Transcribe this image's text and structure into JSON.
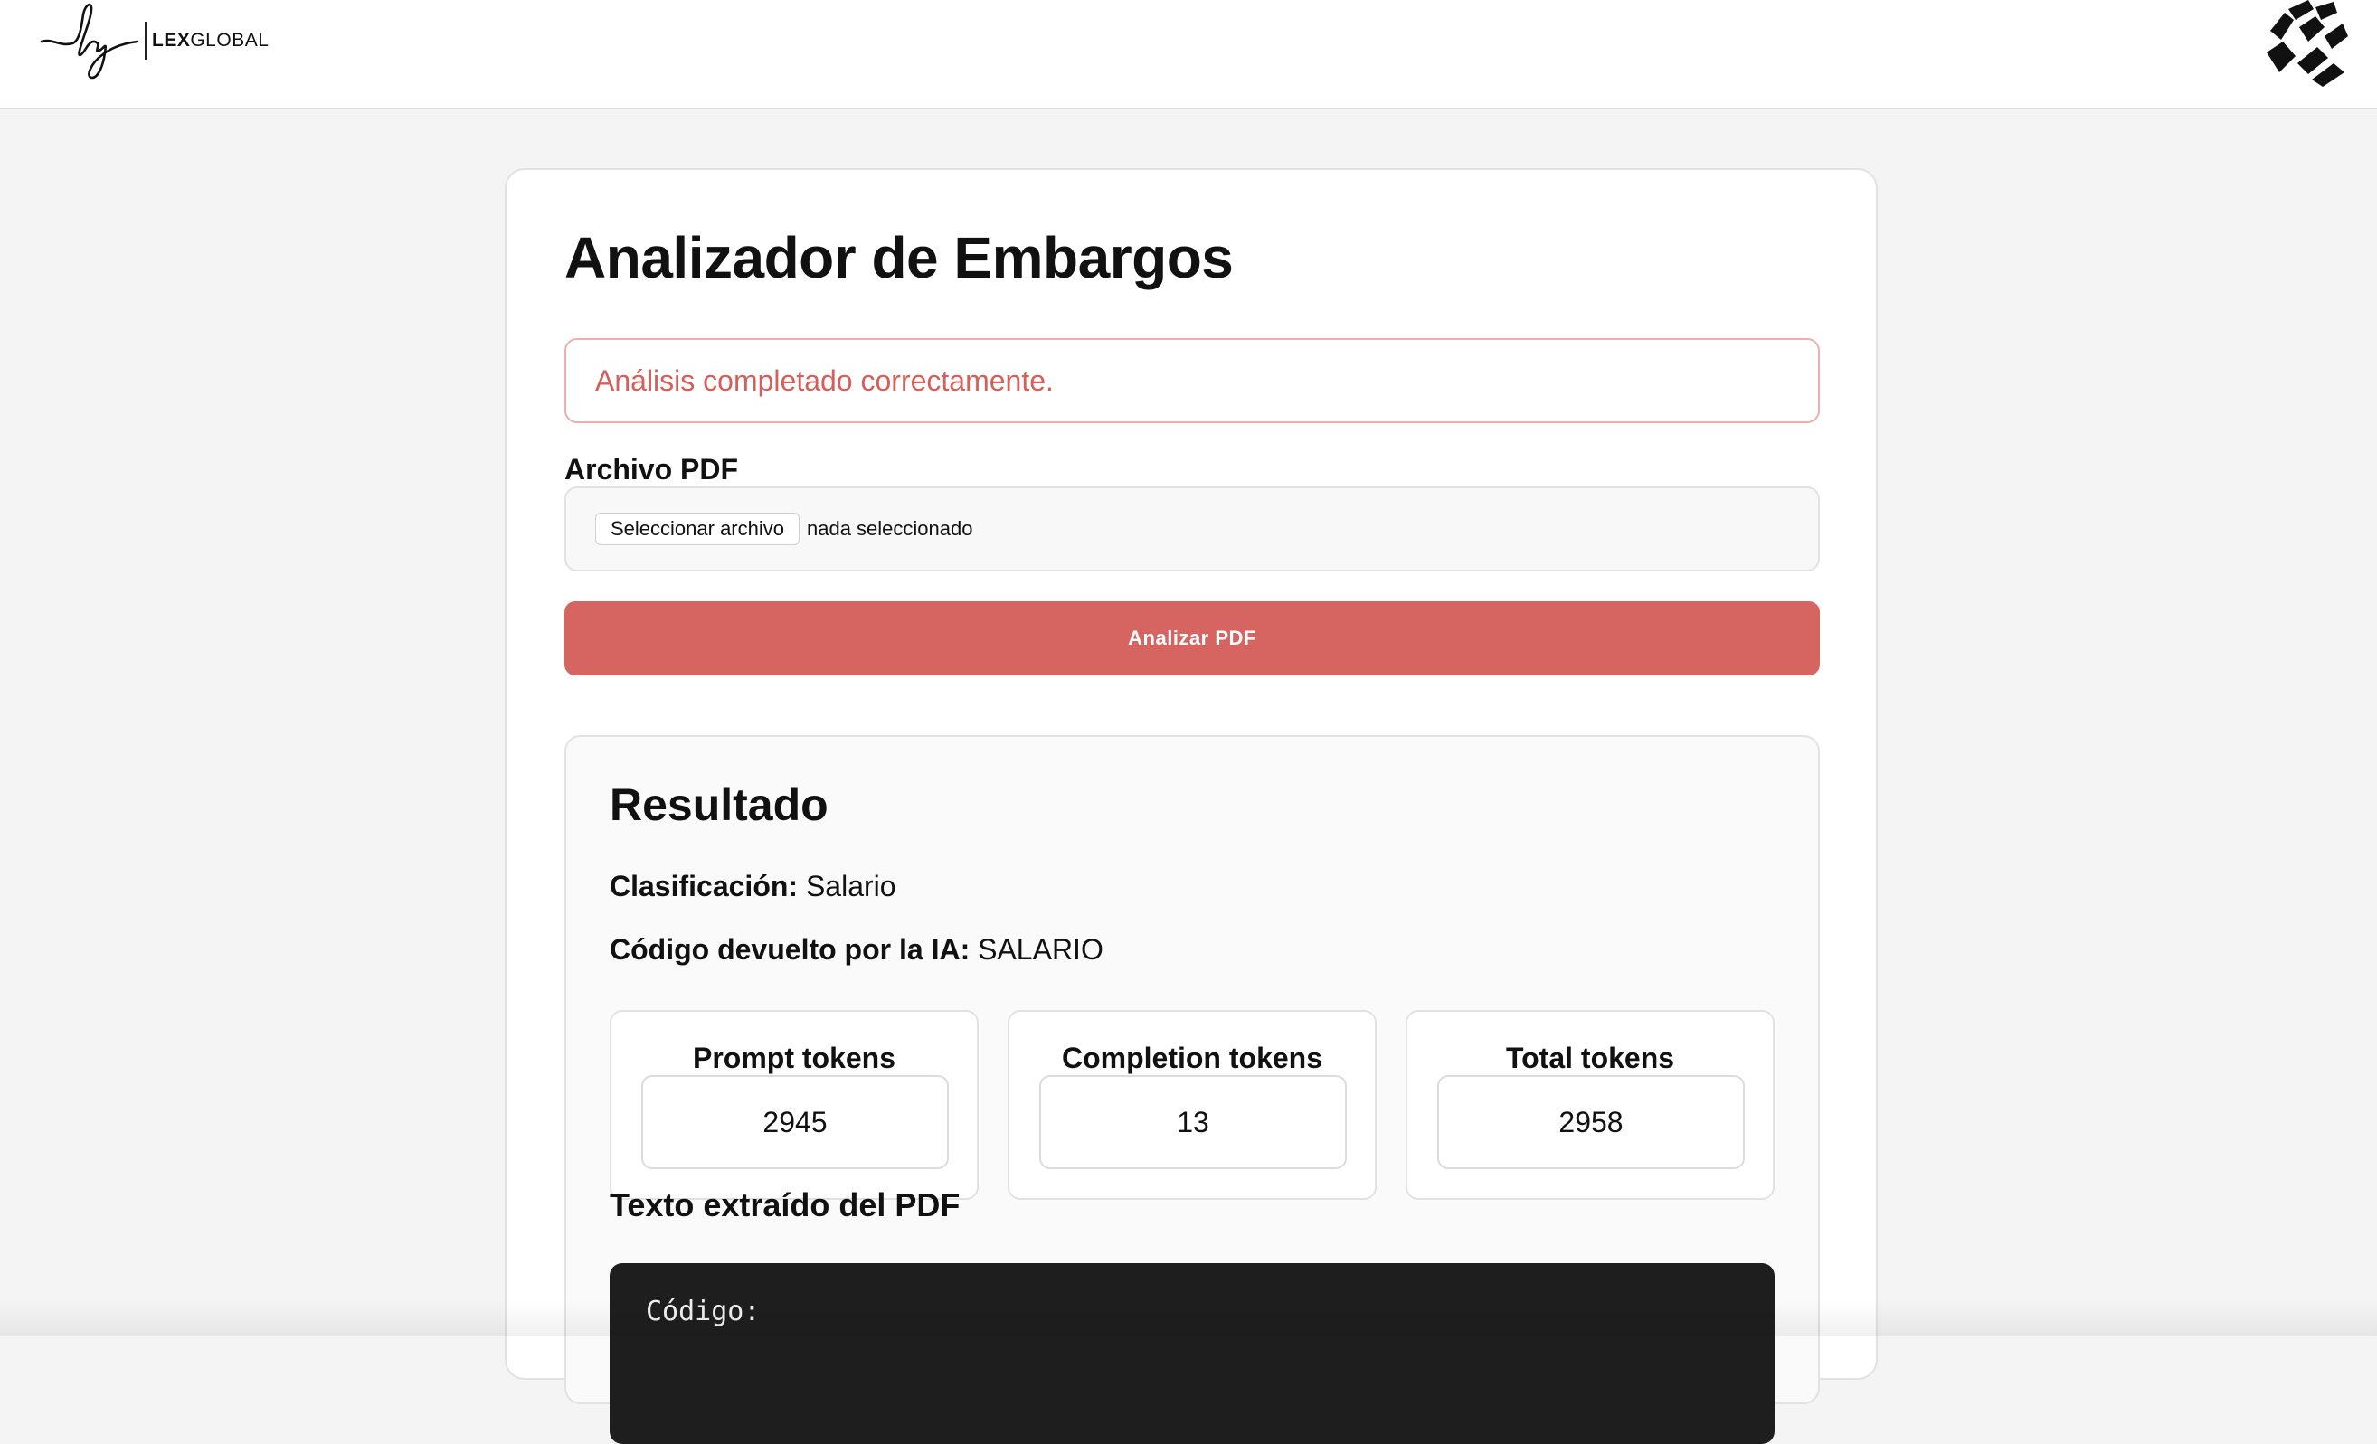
{
  "header": {
    "brand": {
      "prefix": "LEX",
      "suffix": "GLOBAL"
    },
    "logo_icon": "lg-signature-logo",
    "corner_icon": "brand-mark-icon"
  },
  "main": {
    "title": "Analizador de Embargos",
    "alert": {
      "text": "Análisis completado correctamente.",
      "color": "#d5605b"
    },
    "file_field": {
      "label": "Archivo PDF",
      "button_label": "Seleccionar archivo",
      "status": "nada seleccionado"
    },
    "analyze_button": {
      "label": "Analizar PDF",
      "color": "#d66561"
    }
  },
  "result": {
    "title": "Resultado",
    "classification": {
      "label": "Clasificación:",
      "value": "Salario"
    },
    "ai_code": {
      "label": "Código devuelto por la IA:",
      "value": "SALARIO"
    },
    "stats": [
      {
        "label": "Prompt tokens",
        "value": "2945"
      },
      {
        "label": "Completion tokens",
        "value": "13"
      },
      {
        "label": "Total tokens",
        "value": "2958"
      }
    ],
    "extract_title": "Texto extraído del PDF",
    "extract_first_line": "Código:"
  }
}
